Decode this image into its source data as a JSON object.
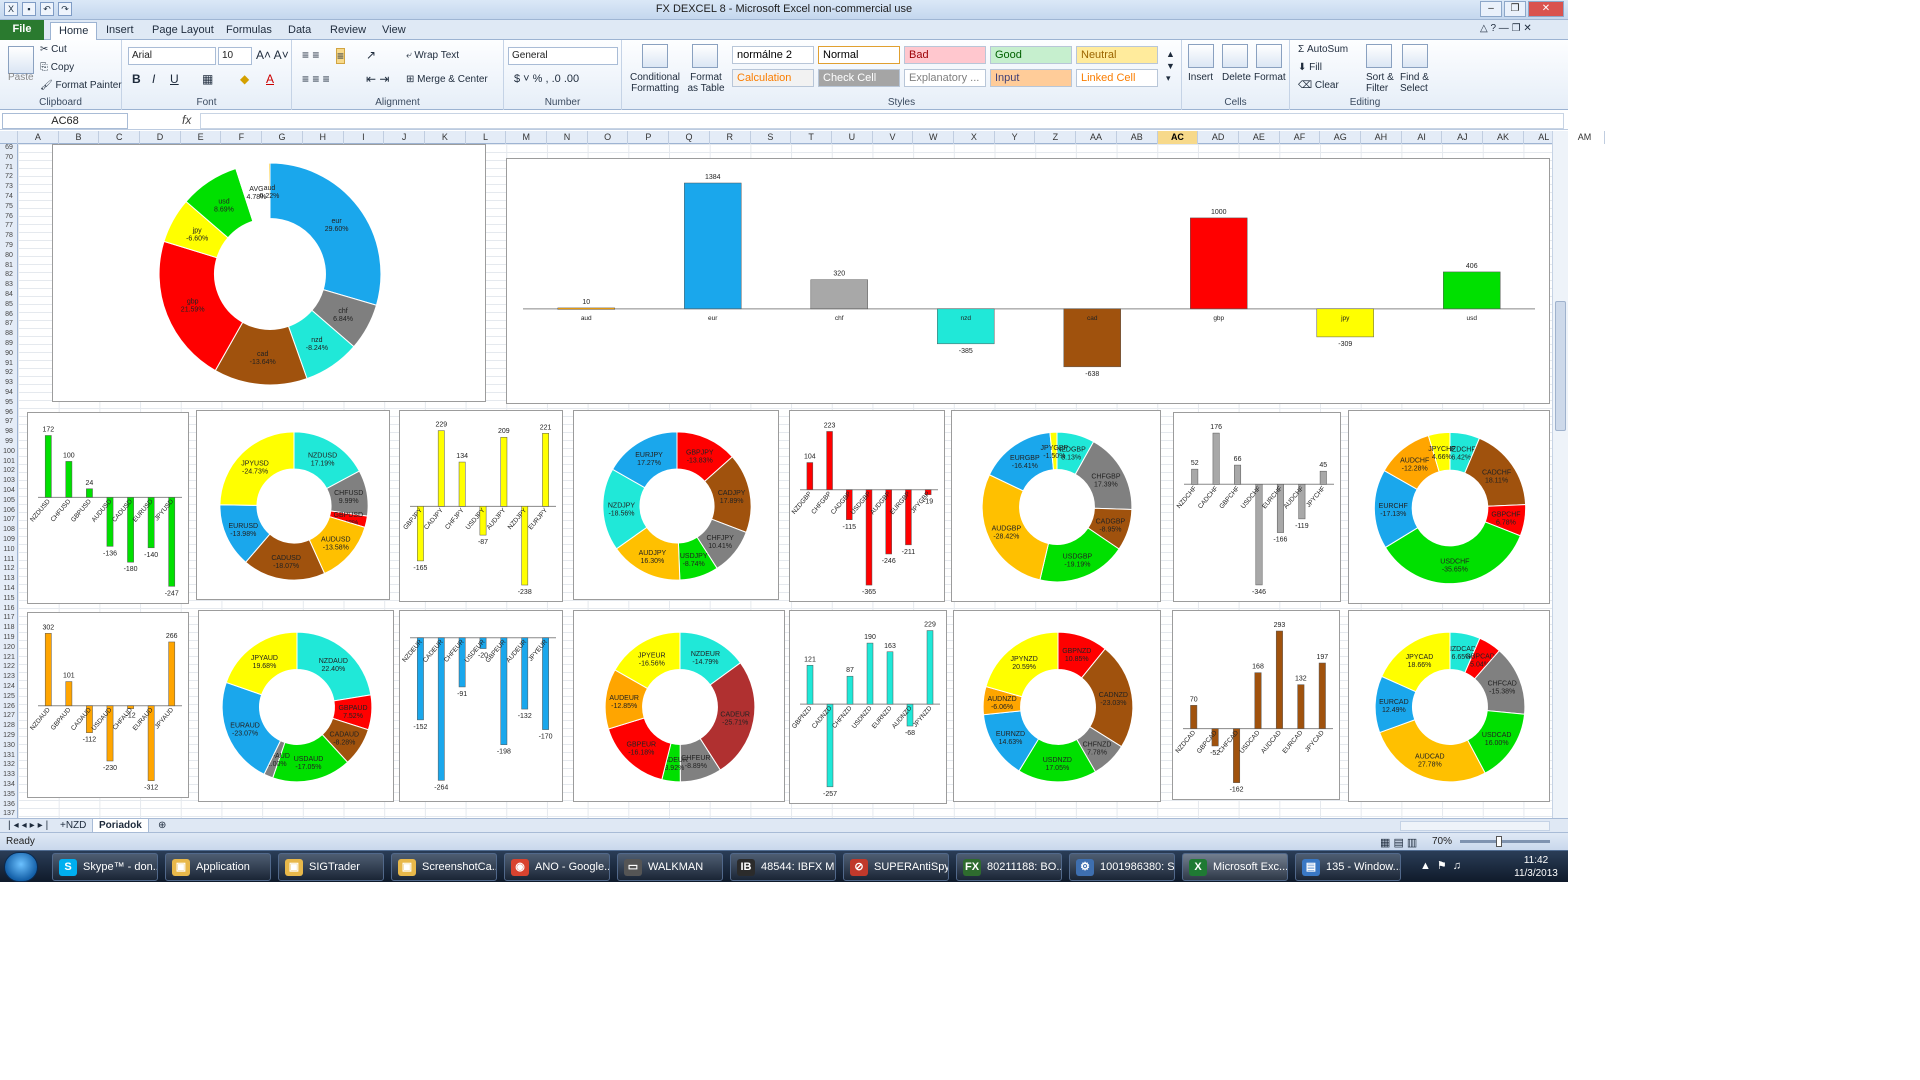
{
  "window": {
    "title": "FX DEXCEL 8  -  Microsoft Excel non-commercial use"
  },
  "ribbon_tabs": [
    "File",
    "Home",
    "Insert",
    "Page Layout",
    "Formulas",
    "Data",
    "Review",
    "View"
  ],
  "clipboard": {
    "paste": "Paste",
    "cut": "Cut",
    "copy": "Copy",
    "format_painter": "Format Painter",
    "label": "Clipboard"
  },
  "font": {
    "name": "Arial",
    "size": "10",
    "label": "Font"
  },
  "alignment": {
    "wrap": "Wrap Text",
    "merge": "Merge & Center",
    "label": "Alignment"
  },
  "number": {
    "format": "General",
    "label": "Number"
  },
  "styles": {
    "conditional": "Conditional Formatting",
    "format_table": "Format as Table",
    "label": "Styles",
    "cells": [
      {
        "text": "normálne 2",
        "bg": "#ffffff",
        "fg": "#000000"
      },
      {
        "text": "Normal",
        "bg": "#ffffff",
        "fg": "#000000"
      },
      {
        "text": "Bad",
        "bg": "#ffc7ce",
        "fg": "#9c0006"
      },
      {
        "text": "Good",
        "bg": "#c6efce",
        "fg": "#006100"
      },
      {
        "text": "Neutral",
        "bg": "#ffeb9c",
        "fg": "#9c6500"
      },
      {
        "text": "Calculation",
        "bg": "#f2f2f2",
        "fg": "#fa7d00"
      },
      {
        "text": "Check Cell",
        "bg": "#a5a5a5",
        "fg": "#ffffff"
      },
      {
        "text": "Explanatory ...",
        "bg": "#ffffff",
        "fg": "#7f7f7f"
      },
      {
        "text": "Input",
        "bg": "#ffcc99",
        "fg": "#3f3f76"
      },
      {
        "text": "Linked Cell",
        "bg": "#ffffff",
        "fg": "#fa7d00"
      }
    ]
  },
  "cells_group": {
    "insert": "Insert",
    "delete": "Delete",
    "format": "Format",
    "label": "Cells"
  },
  "editing": {
    "autosum": "AutoSum",
    "fill": "Fill",
    "clear": "Clear",
    "sort": "Sort & Filter",
    "find": "Find & Select",
    "label": "Editing"
  },
  "formula_bar": {
    "name_box": "AC68",
    "fx": "fx",
    "value": ""
  },
  "columns": [
    "A",
    "B",
    "C",
    "D",
    "E",
    "F",
    "G",
    "H",
    "I",
    "J",
    "K",
    "L",
    "M",
    "N",
    "O",
    "P",
    "Q",
    "R",
    "S",
    "T",
    "U",
    "V",
    "W",
    "X",
    "Y",
    "Z",
    "AA",
    "AB",
    "AC",
    "AD",
    "AE",
    "AF",
    "AG",
    "AH",
    "AI",
    "AJ",
    "AK",
    "AL",
    "AM"
  ],
  "selected_column": "AC",
  "row_start": 69,
  "row_end": 137,
  "sheets": [
    "+NZD",
    "Poriadok"
  ],
  "active_sheet": "Poriadok",
  "status": {
    "ready": "Ready",
    "zoom": "70%"
  },
  "taskbar": {
    "items": [
      {
        "label": "Skype™ - don...",
        "icon": "S",
        "color": "#00aff0"
      },
      {
        "label": "Application",
        "icon": "▣",
        "color": "#e8b84a"
      },
      {
        "label": "SIGTrader",
        "icon": "▣",
        "color": "#e8b84a"
      },
      {
        "label": "ScreenshotCa...",
        "icon": "▣",
        "color": "#e8b84a"
      },
      {
        "label": "ANO - Google...",
        "icon": "◉",
        "color": "#d9432f"
      },
      {
        "label": "WALKMAN",
        "icon": "▭",
        "color": "#555555"
      },
      {
        "label": "48544: IBFX M...",
        "icon": "IB",
        "color": "#2b2b2b"
      },
      {
        "label": "SUPERAntiSpy...",
        "icon": "⊘",
        "color": "#c0392b"
      },
      {
        "label": "80211188: BO...",
        "icon": "FX",
        "color": "#2e6b2e"
      },
      {
        "label": "1001986380: S...",
        "icon": "⚙",
        "color": "#3e6fb0"
      },
      {
        "label": "Microsoft Exc...",
        "icon": "X",
        "color": "#1f7a33"
      },
      {
        "label": "135 - Window...",
        "icon": "▤",
        "color": "#3a78c4"
      }
    ],
    "time": "11:42",
    "date": "11/3/2013"
  },
  "chart_data": [
    {
      "id": "main-donut",
      "type": "pie",
      "donut": true,
      "categories": [
        "eur",
        "chf",
        "nzd",
        "cad",
        "gbp",
        "jpy",
        "usd",
        "AVG",
        "aud"
      ],
      "values": [
        29.6,
        6.84,
        8.24,
        13.64,
        21.59,
        6.6,
        8.69,
        4.78,
        0.22
      ],
      "labels": [
        "29.60%",
        "6.84%",
        "-8.24%",
        "-13.64%",
        "21.59%",
        "-6.60%",
        "8.69%",
        "4.78%",
        "0.22%"
      ],
      "colors": [
        "#1aa7ec",
        "#7f7f7f",
        "#20e8d8",
        "#a0520d",
        "#ff0000",
        "#ffff00",
        "#00e000",
        "#ffffff",
        "#ffc000"
      ]
    },
    {
      "id": "main-bar",
      "type": "bar",
      "categories": [
        "aud",
        "eur",
        "chf",
        "nzd",
        "cad",
        "gbp",
        "jpy",
        "usd"
      ],
      "values": [
        10,
        1384,
        320,
        -385,
        -638,
        1000,
        -309,
        406
      ],
      "colors": [
        "#ffa500",
        "#1aa7ec",
        "#a8a8a8",
        "#20e8d8",
        "#a0520d",
        "#ff0000",
        "#ffff00",
        "#00e000"
      ],
      "ylim": [
        -750,
        1450
      ]
    },
    {
      "id": "usd-bar",
      "type": "bar",
      "color": "#00e000",
      "categories": [
        "NZDUSD",
        "CHFUSD",
        "GBPUSD",
        "AUDUSD",
        "CADUSD",
        "EURUSD",
        "JPYUSD"
      ],
      "values": [
        172,
        100,
        24,
        -136,
        -180,
        -140,
        -247
      ],
      "ylim": [
        -260,
        190
      ]
    },
    {
      "id": "usd-donut",
      "type": "pie",
      "donut": true,
      "categories": [
        "NZDUSD",
        "CHFUSD",
        "GBPUSD",
        "AUDUSD",
        "CADUSD",
        "EURUSD",
        "JPYUSD"
      ],
      "values": [
        17.19,
        9.99,
        2.48,
        13.58,
        18.07,
        13.98,
        24.73
      ],
      "labels": [
        "17.19%",
        "9.99%",
        "2.48%",
        "-13.58%",
        "-18.07%",
        "-13.98%",
        "-24.73%"
      ],
      "colors": [
        "#20e8d8",
        "#808080",
        "#ff0000",
        "#ffc000",
        "#a0520d",
        "#1aa7ec",
        "#ffff00"
      ]
    },
    {
      "id": "jpy-bar",
      "type": "bar",
      "color": "#ffff00",
      "categories": [
        "GBPJPY",
        "CADJPY",
        "CHFJPY",
        "USDJPY",
        "AUDJPY",
        "NZDJPY",
        "EURJPY"
      ],
      "values": [
        -165,
        229,
        134,
        -87,
        209,
        -238,
        221
      ],
      "ylim": [
        -250,
        240
      ]
    },
    {
      "id": "jpy-donut",
      "type": "pie",
      "donut": true,
      "categories": [
        "GBPJPY",
        "CADJPY",
        "CHFJPY",
        "USDJPY",
        "AUDJPY",
        "NZDJPY",
        "EURJPY"
      ],
      "values": [
        13.83,
        17.89,
        10.41,
        8.74,
        16.3,
        18.56,
        17.27
      ],
      "labels": [
        "-13.83%",
        "17.89%",
        "10.41%",
        "-8.74%",
        "16.30%",
        "-18.56%",
        "17.27%"
      ],
      "colors": [
        "#ff0000",
        "#a0520d",
        "#808080",
        "#00e000",
        "#ffc000",
        "#20e8d8",
        "#1aa7ec"
      ]
    },
    {
      "id": "gbp-bar",
      "type": "bar",
      "color": "#ff0000",
      "categories": [
        "NZDGBP",
        "CHFGBP",
        "CADGBP",
        "USDGBP",
        "AUDGBP",
        "EURGBP",
        "JPYGBP"
      ],
      "values": [
        104,
        223,
        -115,
        -365,
        -246,
        -211,
        -19
      ],
      "ylim": [
        -380,
        240
      ]
    },
    {
      "id": "gbp-donut",
      "type": "pie",
      "donut": true,
      "categories": [
        "NZDGBP",
        "CHFGBP",
        "CADGBP",
        "USDGBP",
        "AUDGBP",
        "EURGBP",
        "JPYGBP"
      ],
      "values": [
        8.13,
        17.39,
        8.95,
        19.19,
        28.42,
        16.41,
        1.5
      ],
      "labels": [
        "8.13%",
        "17.39%",
        "-8.95%",
        "-19.19%",
        "-28.42%",
        "-16.41%",
        "-1.50%"
      ],
      "colors": [
        "#20e8d8",
        "#808080",
        "#a0520d",
        "#00e000",
        "#ffc000",
        "#1aa7ec",
        "#ffff00"
      ]
    },
    {
      "id": "chf-bar",
      "type": "bar",
      "color": "#a8a8a8",
      "categories": [
        "NZDCHF",
        "CADCHF",
        "GBPCHF",
        "USDCHF",
        "EURCHF",
        "AUDCHF",
        "JPYCHF"
      ],
      "values": [
        52,
        176,
        66,
        -346,
        -166,
        -119,
        45
      ],
      "ylim": [
        -360,
        190
      ]
    },
    {
      "id": "chf-donut",
      "type": "pie",
      "donut": true,
      "categories": [
        "NZDCHF",
        "CADCHF",
        "GBPCHF",
        "USDCHF",
        "EURCHF",
        "AUDCHF",
        "JPYCHF"
      ],
      "values": [
        6.42,
        18.11,
        6.78,
        35.65,
        17.13,
        12.28,
        4.66
      ],
      "labels": [
        "6.42%",
        "18.11%",
        "6.78%",
        "-35.65%",
        "-17.13%",
        "-12.28%",
        "4.66%"
      ],
      "colors": [
        "#20e8d8",
        "#a0520d",
        "#ff0000",
        "#00e000",
        "#1aa7ec",
        "#ffa500",
        "#ffff00"
      ]
    },
    {
      "id": "aud-bar",
      "type": "bar",
      "color": "#ffa500",
      "categories": [
        "NZDAUD",
        "GBPAUD",
        "CADAUD",
        "USDAUD",
        "CHFAUD",
        "EURAUD",
        "JPYAUD"
      ],
      "values": [
        302,
        101,
        -112,
        -230,
        -12,
        -312,
        266
      ],
      "ylim": [
        -330,
        320
      ]
    },
    {
      "id": "aud-donut",
      "type": "pie",
      "donut": true,
      "categories": [
        "NZDAUD",
        "GBPAUD",
        "CADAUD",
        "USDAUD",
        "CHFAUD",
        "EURAUD",
        "JPYAUD"
      ],
      "values": [
        22.4,
        7.52,
        8.28,
        17.05,
        2.0,
        23.07,
        19.68
      ],
      "labels": [
        "22.40%",
        "7.52%",
        "-8.28%",
        "-17.05%",
        "-2.00%",
        "-23.07%",
        "19.68%"
      ],
      "colors": [
        "#20e8d8",
        "#ff0000",
        "#a0520d",
        "#00e000",
        "#808080",
        "#1aa7ec",
        "#ffff00"
      ]
    },
    {
      "id": "eur-bar",
      "type": "bar",
      "color": "#1aa7ec",
      "categories": [
        "NZDEUR",
        "CADEUR",
        "CHFEUR",
        "USDEUR",
        "GBPEUR",
        "AUDEUR",
        "JPYEUR"
      ],
      "values": [
        -152,
        -264,
        -91,
        -20,
        -198,
        -132,
        -170
      ],
      "ylim": [
        -280,
        20
      ]
    },
    {
      "id": "eur-donut",
      "type": "pie",
      "donut": true,
      "categories": [
        "NZDEUR",
        "CADEUR",
        "CHFEUR",
        "USDEUR",
        "GBPEUR",
        "AUDEUR",
        "JPYEUR"
      ],
      "values": [
        14.79,
        25.71,
        8.89,
        3.92,
        16.18,
        12.85,
        16.56
      ],
      "labels": [
        "-14.79%",
        "-25.71%",
        "-8.89%",
        "-3.92%",
        "-16.18%",
        "-12.85%",
        "-16.56%"
      ],
      "colors": [
        "#20e8d8",
        "#b03030",
        "#808080",
        "#00e000",
        "#ff0000",
        "#ffa500",
        "#ffff00"
      ]
    },
    {
      "id": "nzd-bar",
      "type": "bar",
      "color": "#20e8d8",
      "categories": [
        "GBPNZD",
        "CADNZD",
        "CHFNZD",
        "USDNZD",
        "EURNZD",
        "AUDNZD",
        "JPYNZD"
      ],
      "values": [
        121,
        -257,
        87,
        190,
        163,
        -68,
        229
      ],
      "ylim": [
        -270,
        240
      ]
    },
    {
      "id": "nzd-donut",
      "type": "pie",
      "donut": true,
      "categories": [
        "GBPNZD",
        "CADNZD",
        "CHFNZD",
        "USDNZD",
        "EURNZD",
        "AUDNZD",
        "JPYNZD"
      ],
      "values": [
        10.85,
        23.03,
        7.78,
        17.05,
        14.63,
        6.06,
        20.59
      ],
      "labels": [
        "10.85%",
        "-23.03%",
        "7.78%",
        "17.05%",
        "14.63%",
        "-6.06%",
        "20.59%"
      ],
      "colors": [
        "#ff0000",
        "#a0520d",
        "#808080",
        "#00e000",
        "#1aa7ec",
        "#ffa500",
        "#ffff00"
      ]
    },
    {
      "id": "cad-bar",
      "type": "bar",
      "color": "#a0520d",
      "categories": [
        "NZDCAD",
        "GBPCAD",
        "CHFCAD",
        "USDCAD",
        "AUDCAD",
        "EURCAD",
        "JPYCAD"
      ],
      "values": [
        70,
        -52,
        -162,
        168,
        293,
        132,
        197
      ],
      "ylim": [
        -175,
        305
      ]
    },
    {
      "id": "cad-donut",
      "type": "pie",
      "donut": true,
      "categories": [
        "NZDCAD",
        "GBPCAD",
        "CHFCAD",
        "USDCAD",
        "AUDCAD",
        "EURCAD",
        "JPYCAD"
      ],
      "values": [
        6.65,
        5.04,
        15.38,
        16.0,
        27.78,
        12.49,
        18.66
      ],
      "labels": [
        "6.65%",
        "5.04%",
        "-15.38%",
        "16.00%",
        "27.78%",
        "12.49%",
        "18.66%"
      ],
      "colors": [
        "#20e8d8",
        "#ff0000",
        "#808080",
        "#00e000",
        "#ffc000",
        "#1aa7ec",
        "#ffff00"
      ]
    }
  ]
}
